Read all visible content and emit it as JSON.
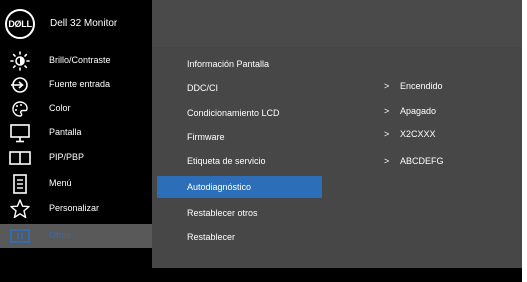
{
  "header": {
    "logo_text": "DØLL",
    "title": "Dell 32 Monitor"
  },
  "sidebar": {
    "items": [
      {
        "label": "Brillo/Contraste",
        "icon": "brightness-icon"
      },
      {
        "label": "Fuente entrada",
        "icon": "input-source-icon"
      },
      {
        "label": "Color",
        "icon": "color-palette-icon"
      },
      {
        "label": "Pantalla",
        "icon": "display-icon"
      },
      {
        "label": "PIP/PBP",
        "icon": "pip-pbp-icon"
      },
      {
        "label": "Menú",
        "icon": "menu-icon"
      },
      {
        "label": "Personalizar",
        "icon": "star-icon"
      },
      {
        "label": "Otros",
        "icon": "others-icon",
        "active": true
      }
    ]
  },
  "submenu": {
    "items": [
      {
        "label": "Información Pantalla"
      },
      {
        "label": "DDC/CI"
      },
      {
        "label": "Condicionamiento LCD"
      },
      {
        "label": "Firmware"
      },
      {
        "label": "Etiqueta de servicio"
      },
      {
        "label": "Autodiagnóstico",
        "selected": true
      },
      {
        "label": "Restablecer otros"
      },
      {
        "label": "Restablecer"
      }
    ]
  },
  "values": [
    {
      "chevron": ">",
      "text": "Encendido"
    },
    {
      "chevron": ">",
      "text": "Apagado"
    },
    {
      "chevron": ">",
      "text": "X2CXXX"
    },
    {
      "chevron": ">",
      "text": "ABCDEFG"
    }
  ],
  "colors": {
    "accent": "#2c6eb8",
    "panel": "#474747",
    "sidebar": "#000000",
    "active_sidebar": "#595959"
  }
}
